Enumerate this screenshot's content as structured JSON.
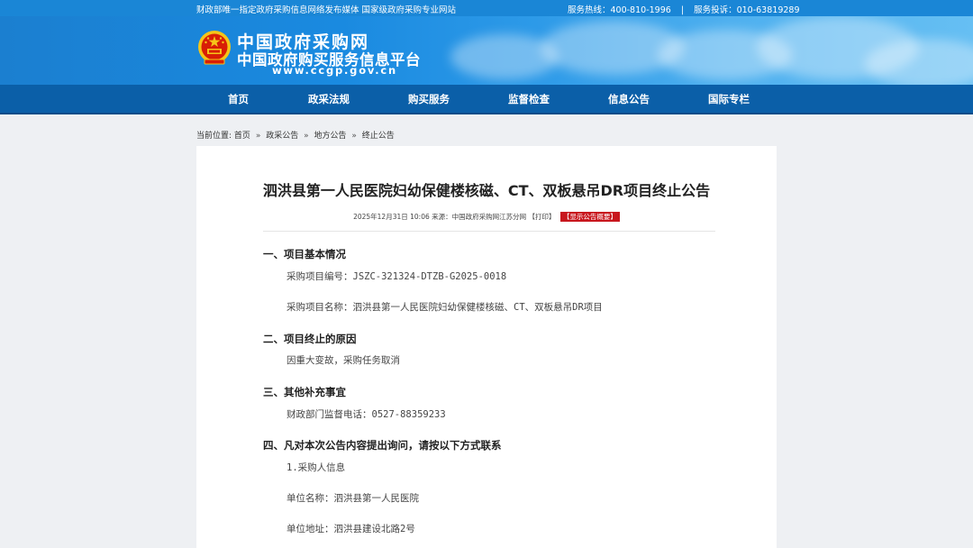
{
  "topbar": {
    "tagline": "财政部唯一指定政府采购信息网络发布媒体  国家级政府采购专业网站",
    "hotline": "服务热线：400-810-1996",
    "divider": "|",
    "complaint": "服务投诉：010-63819289"
  },
  "header": {
    "site_name": "中国政府采购网",
    "platform_name": "中国政府购买服务信息平台",
    "url": "www.ccgp.gov.cn"
  },
  "nav": {
    "items": [
      {
        "label": "首页"
      },
      {
        "label": "政采法规"
      },
      {
        "label": "购买服务"
      },
      {
        "label": "监督检查"
      },
      {
        "label": "信息公告"
      },
      {
        "label": "国际专栏"
      }
    ]
  },
  "breadcrumb": {
    "prefix": "当前位置:",
    "items": [
      "首页",
      "政采公告",
      "地方公告",
      "终止公告"
    ],
    "sep": "»"
  },
  "article": {
    "title": "泗洪县第一人民医院妇幼保健楼核磁、CT、双板悬吊DR项目终止公告",
    "datetime": "2025年12月31日 10:06",
    "source": "来源：中国政府采购网江苏分网",
    "print_label": "【打印】",
    "summary_label": "【显示公告概要】",
    "sections": [
      {
        "heading": "一、项目基本情况"
      },
      {
        "heading": "二、项目终止的原因"
      },
      {
        "heading": "三、其他补充事宜"
      },
      {
        "heading": "四、凡对本次公告内容提出询问，请按以下方式联系"
      }
    ],
    "paragraphs": {
      "project_no": "采购项目编号：JSZC-321324-DTZB-G2025-0018",
      "project_name": "采购项目名称：泗洪县第一人民医院妇幼保健楼核磁、CT、双板悬吊DR项目",
      "reason": "因重大变故，采购任务取消",
      "phone": "财政部门监督电话：0527-88359233",
      "buyer_info": "1.采购人信息",
      "unit_name": "单位名称：泗洪县第一人民医院",
      "unit_addr": "单位地址：泗洪县建设北路2号"
    }
  },
  "colors": {
    "topstrip": "#1a86d6",
    "nav": "#0b5fa8",
    "badge": "#c8161d"
  }
}
